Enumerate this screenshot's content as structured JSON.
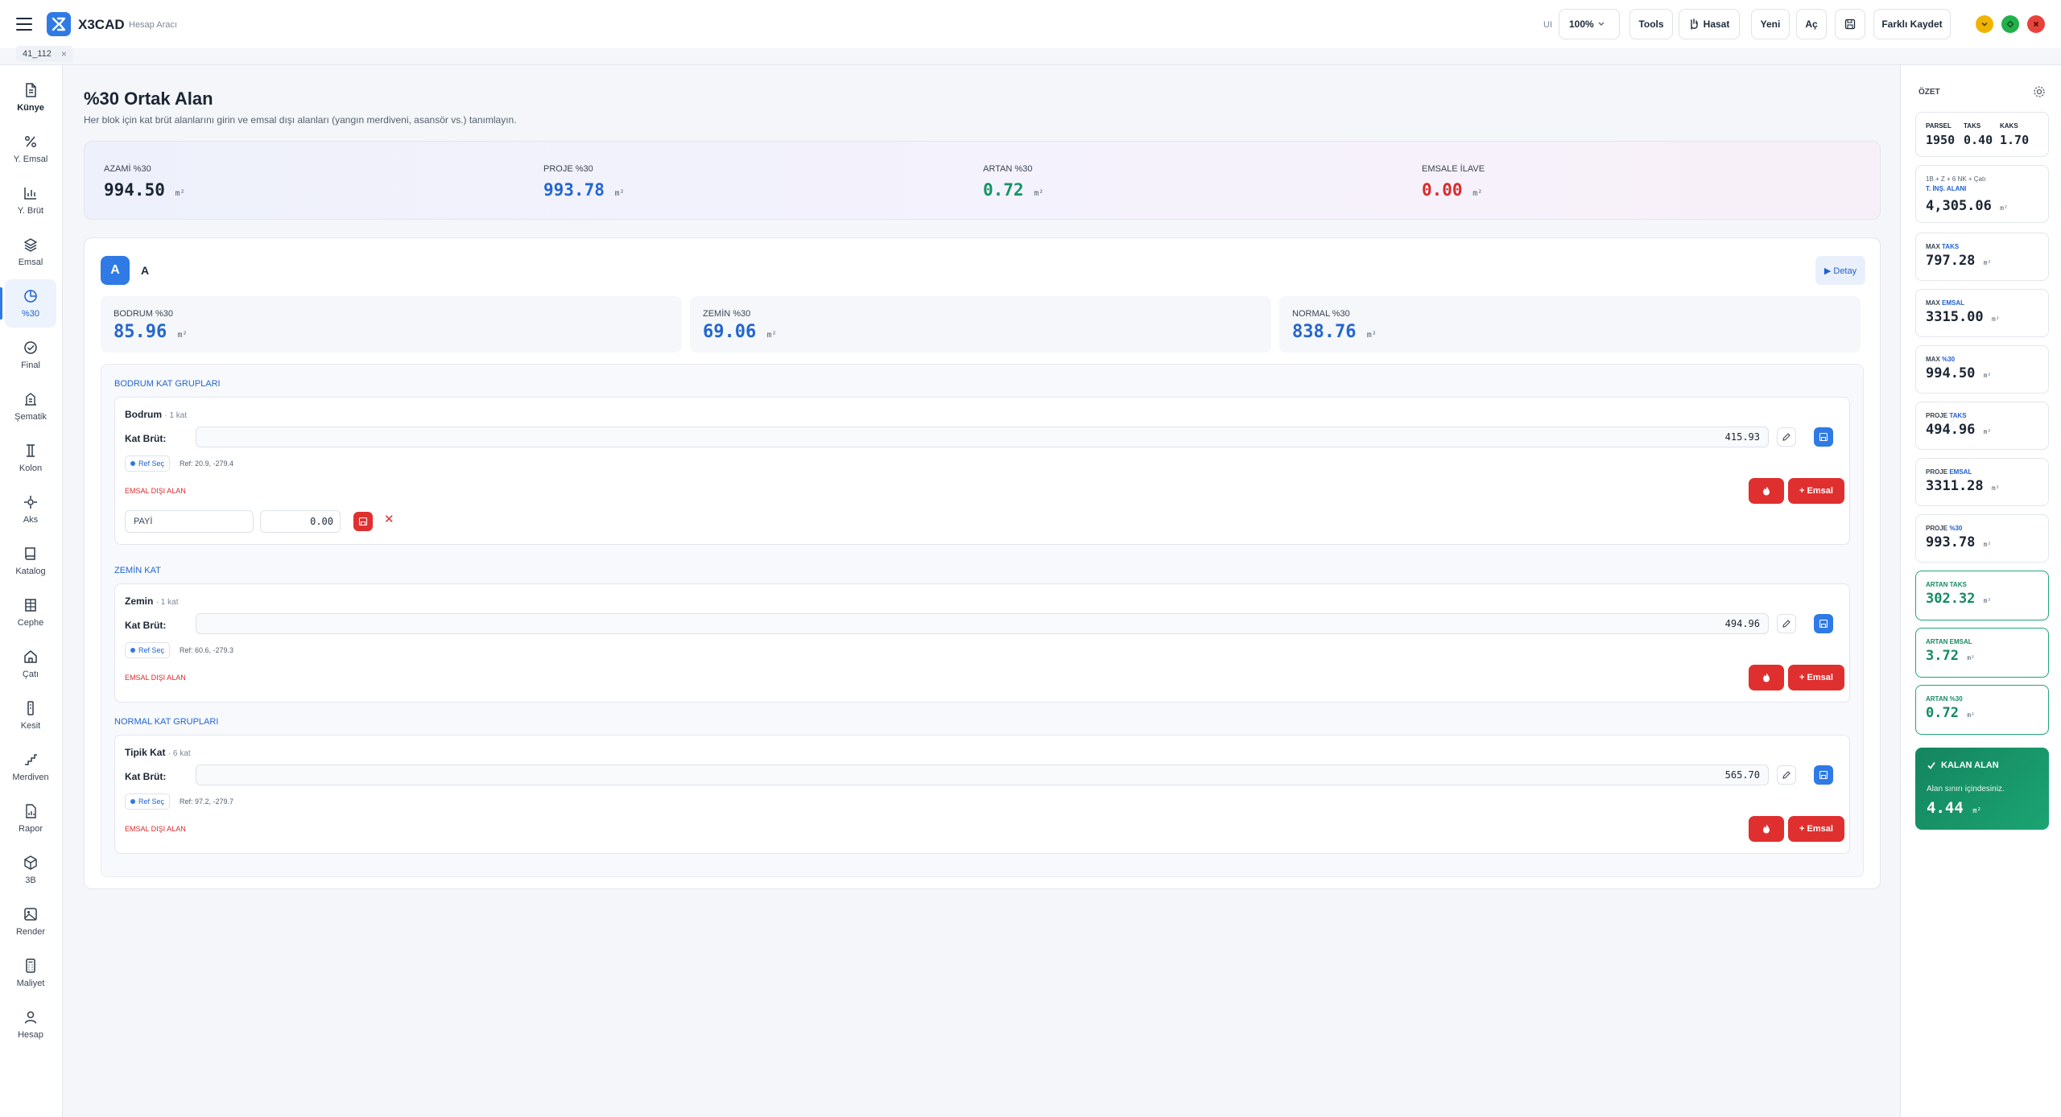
{
  "app": {
    "brand": "X3CAD",
    "subtitle": "Hesap Aracı",
    "tab": "41_112",
    "tab_close": "×"
  },
  "toolbar": {
    "ui_label": "UI",
    "zoom": "100%",
    "tools": "Tools",
    "hasat": "Hasat",
    "yeni": "Yeni",
    "ac": "Aç",
    "farkli_kaydet": "Farklı Kaydet"
  },
  "sidebar": {
    "items": [
      {
        "label": "Künye",
        "icon": "document-icon"
      },
      {
        "label": "Y. Emsal",
        "icon": "percent-icon"
      },
      {
        "label": "Y. Brüt",
        "icon": "bar-chart-icon"
      },
      {
        "label": "Emsal",
        "icon": "layers-icon"
      },
      {
        "label": "%30",
        "icon": "pie-chart-icon"
      },
      {
        "label": "Final",
        "icon": "check-circle-icon"
      },
      {
        "label": "Şematik",
        "icon": "building-icon"
      },
      {
        "label": "Kolon",
        "icon": "column-icon"
      },
      {
        "label": "Aks",
        "icon": "crosshair-icon"
      },
      {
        "label": "Katalog",
        "icon": "book-icon"
      },
      {
        "label": "Cephe",
        "icon": "facade-icon"
      },
      {
        "label": "Çatı",
        "icon": "home-icon"
      },
      {
        "label": "Kesit",
        "icon": "section-icon"
      },
      {
        "label": "Merdiven",
        "icon": "stairs-icon"
      },
      {
        "label": "Rapor",
        "icon": "report-icon"
      },
      {
        "label": "3B",
        "icon": "cube-icon"
      },
      {
        "label": "Render",
        "icon": "image-icon"
      },
      {
        "label": "Maliyet",
        "icon": "calculator-icon"
      },
      {
        "label": "Hesap",
        "icon": "user-icon"
      }
    ]
  },
  "page": {
    "title": "%30 Ortak Alan",
    "subtitle": "Her blok için kat brüt alanlarını girin ve emsal dışı alanları (yangın merdiveni, asansör vs.) tanımlayın."
  },
  "summary": {
    "unit": "m²",
    "items": [
      {
        "label": "AZAMİ %30",
        "value": "994.50",
        "color": "#1b2533"
      },
      {
        "label": "PROJE %30",
        "value": "993.78",
        "color": "#2366cf"
      },
      {
        "label": "ARTAN %30",
        "value": "0.72",
        "color": "#159466"
      },
      {
        "label": "EMSALE İLAVE",
        "value": "0.00",
        "color": "#d92b2b"
      }
    ]
  },
  "block": {
    "badge": "A",
    "name": "A",
    "detay": "▶ Detay",
    "stats": [
      {
        "label": "BODRUM %30",
        "value": "85.96"
      },
      {
        "label": "ZEMİN %30",
        "value": "69.06"
      },
      {
        "label": "NORMAL %30",
        "value": "838.76"
      }
    ],
    "groups": [
      {
        "title": "BODRUM KAT GRUPLARI",
        "floor": "Bodrum",
        "count": "· 1 kat",
        "brut_label": "Kat Brüt:",
        "brut": "415.93",
        "ref_btn": "Ref Seç",
        "ref": "Ref: 20.9, -279.4",
        "emsal_disi": "EMSAL DIŞI ALAN",
        "add_emsal": "+ Emsal",
        "payi_label": "PAYİ",
        "payi_value": "0.00"
      },
      {
        "title": "ZEMİN KAT",
        "floor": "Zemin",
        "count": "· 1 kat",
        "brut_label": "Kat Brüt:",
        "brut": "494.96",
        "ref_btn": "Ref Seç",
        "ref": "Ref: 60.6, -279.3",
        "emsal_disi": "EMSAL DIŞI ALAN",
        "add_emsal": "+ Emsal"
      },
      {
        "title": "NORMAL KAT GRUPLARI",
        "floor": "Tipik Kat",
        "count": "· 6 kat",
        "brut_label": "Kat Brüt:",
        "brut": "565.70",
        "ref_btn": "Ref Seç",
        "ref": "Ref: 97.2, -279.7",
        "emsal_disi": "EMSAL DIŞI ALAN",
        "add_emsal": "+ Emsal"
      }
    ]
  },
  "ozet": {
    "title": "ÖZET",
    "unit": "m²",
    "parsel_label": "PARSEL",
    "parsel": "1950",
    "taks_label": "TAKS",
    "taks": "0.40",
    "kaks_label": "KAKS",
    "kaks": "1.70",
    "ins_note": "1B + Z + 6 NK + Çatı",
    "ins_label": "T. İNŞ. ALANI",
    "ins_value": "4,305.06",
    "cards": [
      {
        "pre": "MAX ",
        "hl": "TAKS",
        "value": "797.28"
      },
      {
        "pre": "MAX ",
        "hl": "EMSAL",
        "value": "3315.00"
      },
      {
        "pre": "MAX ",
        "hl": "%30",
        "value": "994.50"
      },
      {
        "pre": "PROJE ",
        "hl": "TAKS",
        "value": "494.96"
      },
      {
        "pre": "PROJE ",
        "hl": "EMSAL",
        "value": "3311.28"
      },
      {
        "pre": "PROJE ",
        "hl": "%30",
        "value": "993.78"
      }
    ],
    "artan": [
      {
        "label": "ARTAN TAKS",
        "value": "302.32"
      },
      {
        "label": "ARTAN EMSAL",
        "value": "3.72"
      },
      {
        "label": "ARTAN %30",
        "value": "0.72"
      }
    ],
    "kalan_title": "KALAN ALAN",
    "kalan_note": "Alan sınırı içindesiniz.",
    "kalan_value": "4.44"
  }
}
